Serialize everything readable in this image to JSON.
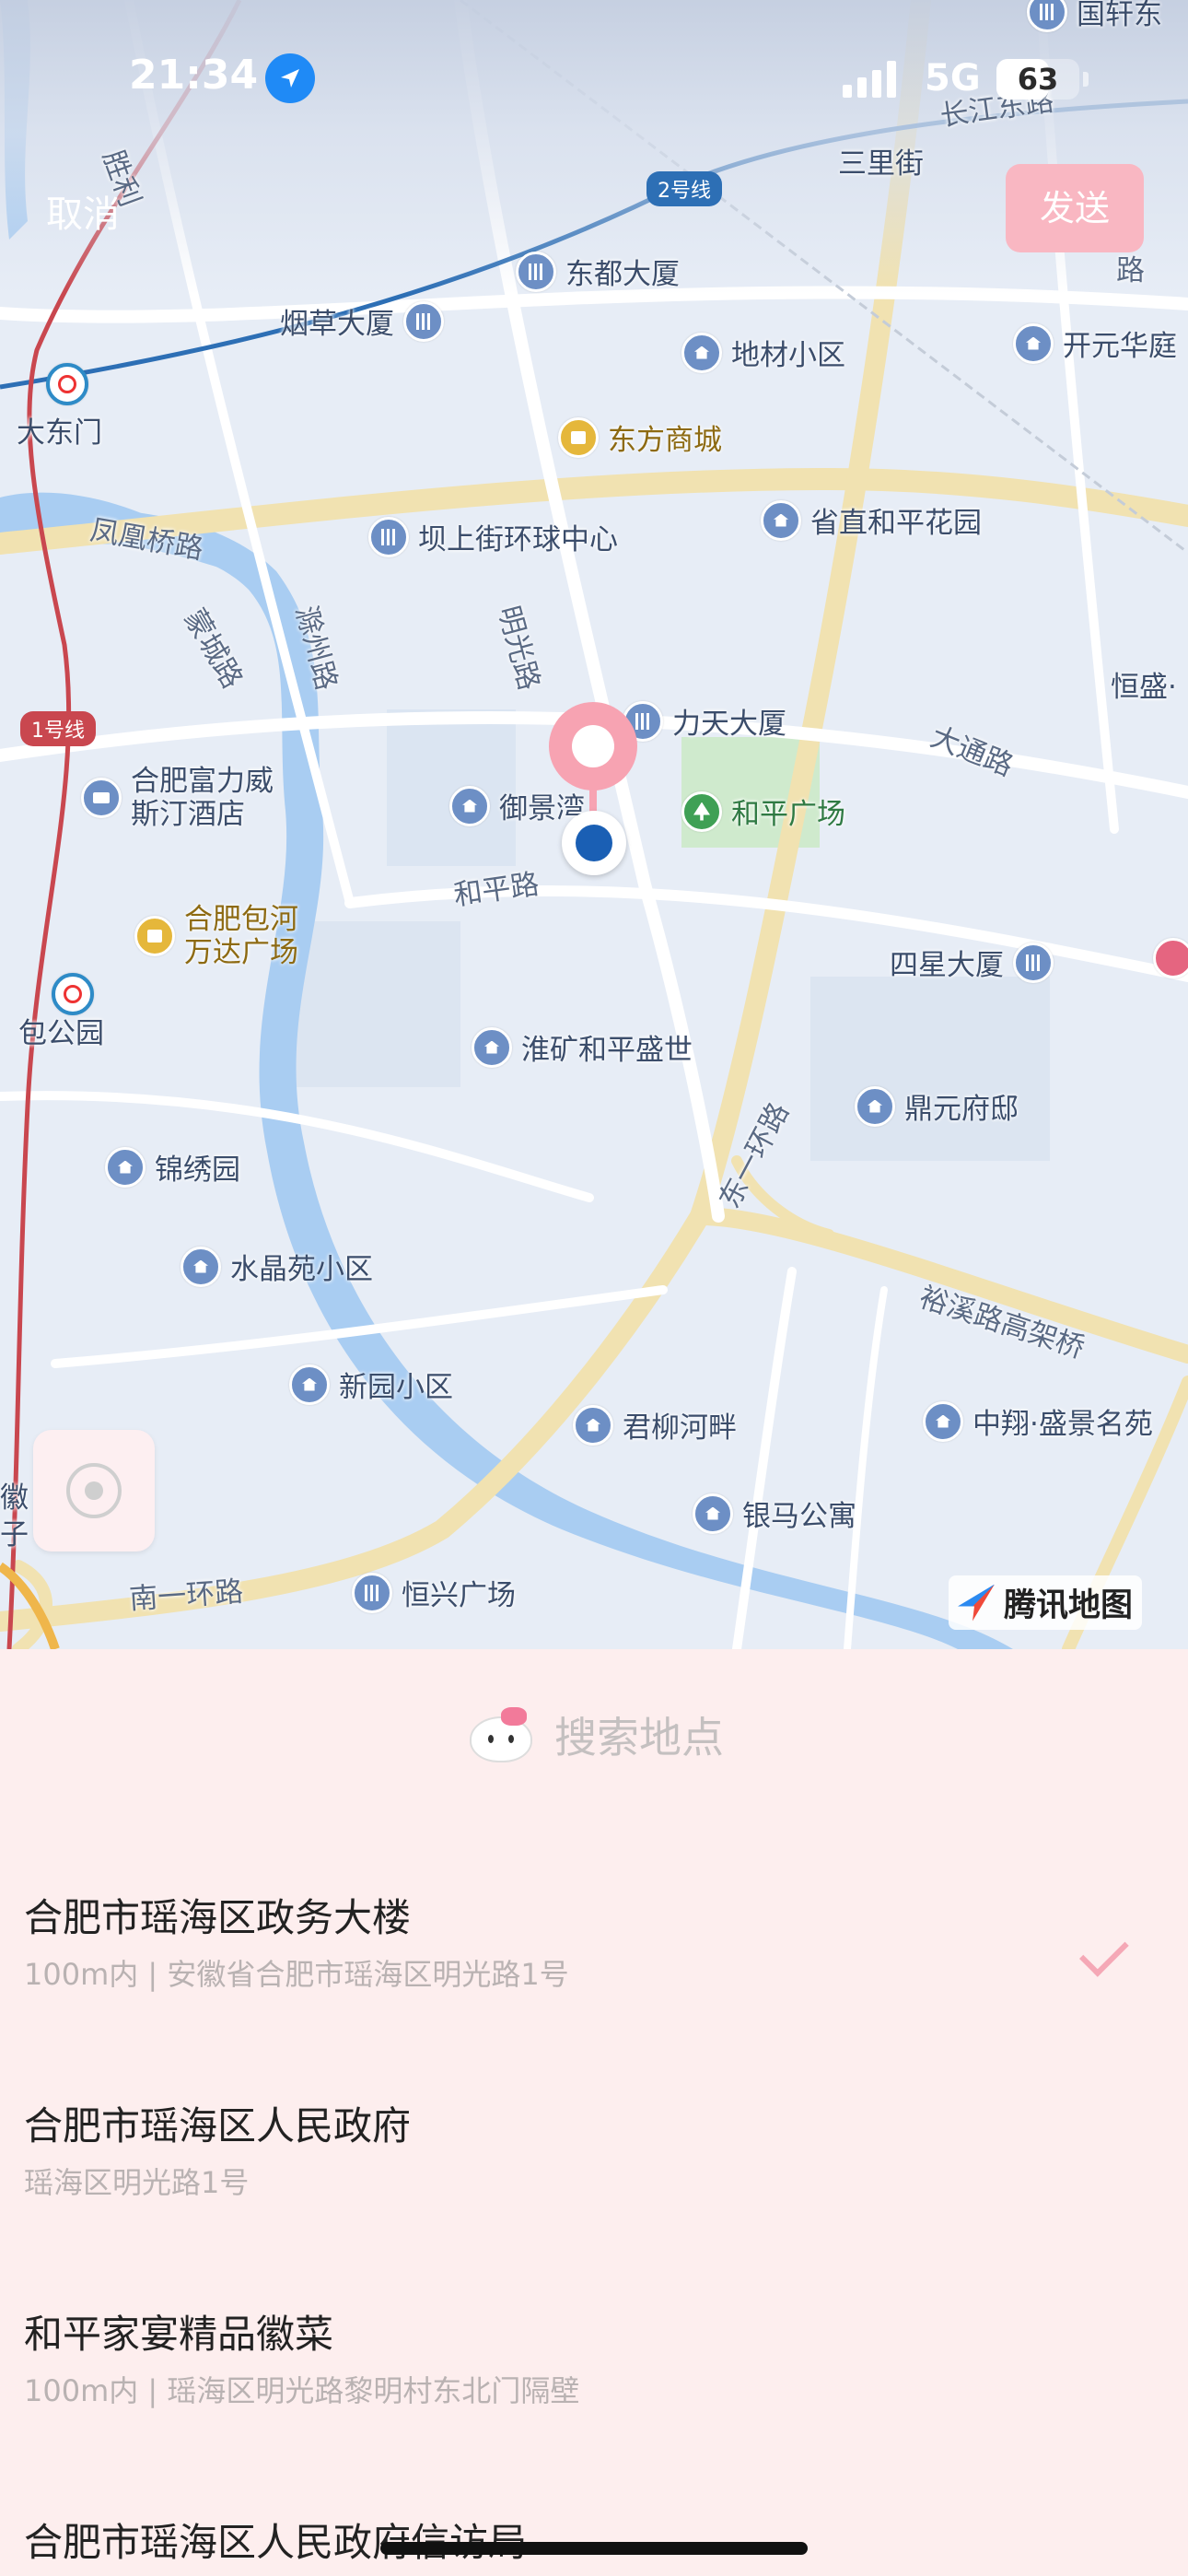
{
  "status_bar": {
    "time": "21:34",
    "network": "5G",
    "battery": "63",
    "battery_level": 0.63
  },
  "header": {
    "cancel_label": "取消",
    "send_label": "发送"
  },
  "map": {
    "pois": {
      "guoxuan": "国轩东",
      "sanlijie": "三里街",
      "dongdu": "东都大厦",
      "yancao": "烟草大厦",
      "dicai": "地材小区",
      "kaiyuan": "开元华庭",
      "dadongmen": "大东门",
      "dongfang": "东方商城",
      "bashang": "坝上街环球中心",
      "shengzhi": "省直和平花园",
      "litian": "力天大厦",
      "hengsheng": "恒盛·",
      "fulihotel_1": "合肥富力威",
      "fulihotel_2": "斯汀酒店",
      "yujing": "御景湾",
      "heping_square": "和平广场",
      "wanda_1": "合肥包河",
      "wanda_2": "万达广场",
      "sixing": "四星大厦",
      "baogongyuan": "包公园",
      "huaikuang": "淮矿和平盛世",
      "dingyuan": "鼎元府邸",
      "jinxiu": "锦绣园",
      "shuijing": "水晶苑小区",
      "xinyuan": "新园小区",
      "junliu": "君柳河畔",
      "zhongxiang": "中翔·盛景名苑",
      "yinma": "银马公寓",
      "hengxing": "恒兴广场",
      "hui": "徽",
      "zi": "子"
    },
    "roads": {
      "changjiang": "长江东路",
      "shengli": "胜利",
      "fenghuang": "凤凰桥路",
      "zhuanxi": "蒙城路",
      "chuzhou": "滁州路",
      "mingguang": "明光路",
      "datong": "大通路",
      "hepinglu": "和平路",
      "dongyihuan": "东一环路",
      "yuxi": "裕溪路高架桥",
      "nanyihuan": "南一环路",
      "lu": "路"
    },
    "lines": {
      "line1": "1号线",
      "line2": "2号线"
    },
    "attribution": "腾讯地图"
  },
  "sheet": {
    "search_placeholder": "搜索地点",
    "items": [
      {
        "title": "合肥市瑶海区政务大楼",
        "subtitle": "100m内 | 安徽省合肥市瑶海区明光路1号",
        "selected": true
      },
      {
        "title": "合肥市瑶海区人民政府",
        "subtitle": "瑶海区明光路1号",
        "selected": false
      },
      {
        "title": "和平家宴精品徽菜",
        "subtitle": "100m内 | 瑶海区明光路黎明村东北门隔壁",
        "selected": false
      },
      {
        "title": "合肥市瑶海区人民政府信访局",
        "subtitle": "",
        "selected": false
      }
    ]
  },
  "colors": {
    "accent_pink": "#f9b7c2",
    "sheet_bg": "#fdeeee",
    "river": "#a9cdf2",
    "road": "#f2e2b4"
  }
}
